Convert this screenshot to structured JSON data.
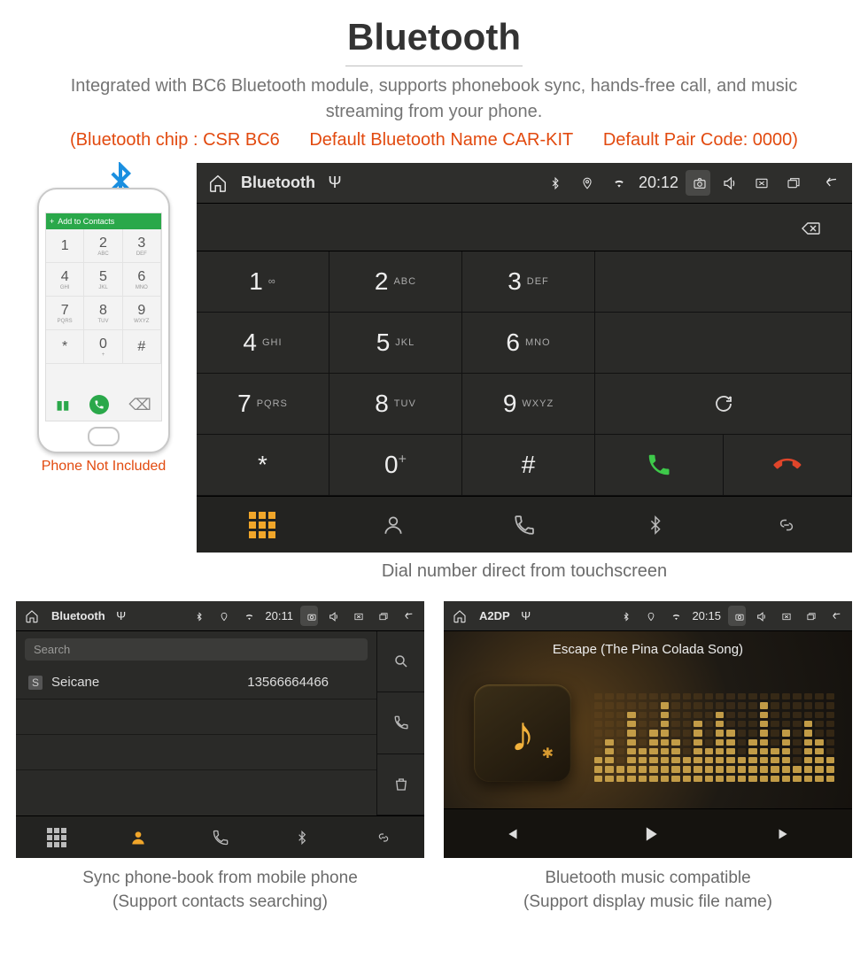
{
  "header": {
    "title": "Bluetooth",
    "description": "Integrated with BC6 Bluetooth module, supports phonebook sync, hands-free call, and music streaming from your phone.",
    "specs": {
      "chip": "(Bluetooth chip : CSR BC6",
      "name": "Default Bluetooth Name CAR-KIT",
      "pair": "Default Pair Code: 0000)"
    }
  },
  "phone_mock": {
    "topbar": "Add to Contacts",
    "keys": [
      {
        "n": "1",
        "l": ""
      },
      {
        "n": "2",
        "l": "ABC"
      },
      {
        "n": "3",
        "l": "DEF"
      },
      {
        "n": "4",
        "l": "GHI"
      },
      {
        "n": "5",
        "l": "JKL"
      },
      {
        "n": "6",
        "l": "MNO"
      },
      {
        "n": "7",
        "l": "PQRS"
      },
      {
        "n": "8",
        "l": "TUV"
      },
      {
        "n": "9",
        "l": "WXYZ"
      },
      {
        "n": "*",
        "l": ""
      },
      {
        "n": "0",
        "l": "+"
      },
      {
        "n": "#",
        "l": ""
      }
    ],
    "note": "Phone Not Included"
  },
  "dialer": {
    "title": "Bluetooth",
    "time": "20:12",
    "keys": [
      [
        {
          "n": "1",
          "l": "∞"
        },
        {
          "n": "2",
          "l": "ABC"
        },
        {
          "n": "3",
          "l": "DEF"
        }
      ],
      [
        {
          "n": "4",
          "l": "GHI"
        },
        {
          "n": "5",
          "l": "JKL"
        },
        {
          "n": "6",
          "l": "MNO"
        }
      ],
      [
        {
          "n": "7",
          "l": "PQRS"
        },
        {
          "n": "8",
          "l": "TUV"
        },
        {
          "n": "9",
          "l": "WXYZ"
        }
      ],
      [
        {
          "n": "*",
          "l": ""
        },
        {
          "n": "0",
          "l": "+",
          "sup": "+"
        },
        {
          "n": "#",
          "l": ""
        }
      ]
    ],
    "caption": "Dial number direct from touchscreen"
  },
  "phonebook": {
    "title": "Bluetooth",
    "time": "20:11",
    "search_placeholder": "Search",
    "contact_tag": "S",
    "contact_name": "Seicane",
    "contact_number": "13566664466",
    "caption_line1": "Sync phone-book from mobile phone",
    "caption_line2": "(Support contacts searching)"
  },
  "music": {
    "title": "A2DP",
    "time": "20:15",
    "track": "Escape (The Pina Colada Song)",
    "caption_line1": "Bluetooth music compatible",
    "caption_line2": "(Support display music file name)"
  }
}
